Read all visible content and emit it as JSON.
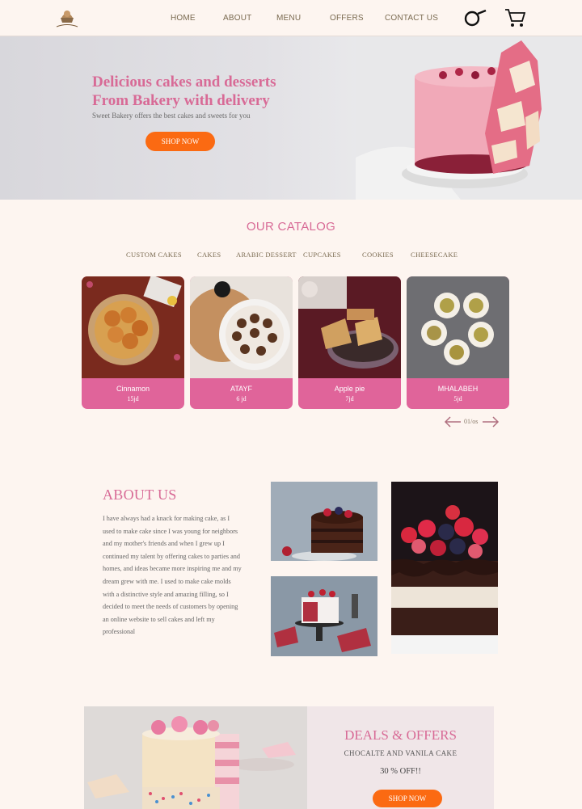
{
  "nav": {
    "logo_alt": "Sweet Bakery",
    "links": [
      "HOME",
      "ABOUT",
      "MENU",
      "OFFERS",
      "CONTACT US"
    ],
    "search_icon": "search-icon",
    "cart_icon": "cart-icon"
  },
  "hero": {
    "title_line1": "Delicious cakes and desserts",
    "title_line2": "From Bakery with delivery",
    "subtitle": "Sweet Bakery offers the best cakes and sweets for you",
    "cta": "SHOP NOW"
  },
  "catalog": {
    "title": "OUR CATALOG",
    "categories": [
      "CUSTOM CAKES",
      "CAKES",
      "ARABIC DESSERT",
      "CUPCAKES",
      "COOKIES",
      "CHEESECAKE"
    ],
    "items": [
      {
        "name": "Cinnamon",
        "price": "15jd"
      },
      {
        "name": "ATAYF",
        "price": "6 jd"
      },
      {
        "name": "Apple pie",
        "price": "7jd"
      },
      {
        "name": "MHALABEH",
        "price": "5jd"
      }
    ],
    "pager": "01/os"
  },
  "about": {
    "title": "ABOUT US",
    "text": "I have always had a knack for making cake, as I used to make cake since I was young for neighbors and my mother's friends and when I grew up I continued my talent by offering cakes to parties and homes, and ideas became more inspiring me and my dream grew with me. I used to make cake molds with a distinctive style and amazing filling, so I decided to meet the needs of customers by opening an online website to sell cakes and left my professional"
  },
  "deals": {
    "title": "DEALS & OFFERS",
    "subtitle": "CHOCALTE  AND VANILA CAKE",
    "offer": "30 % OFF!!",
    "cta": "SHOP NOW"
  },
  "colors": {
    "accent_pink": "#d86a96",
    "card_pink": "#e0649a",
    "button_orange": "#fb6a12",
    "background": "#fdf5f0"
  }
}
